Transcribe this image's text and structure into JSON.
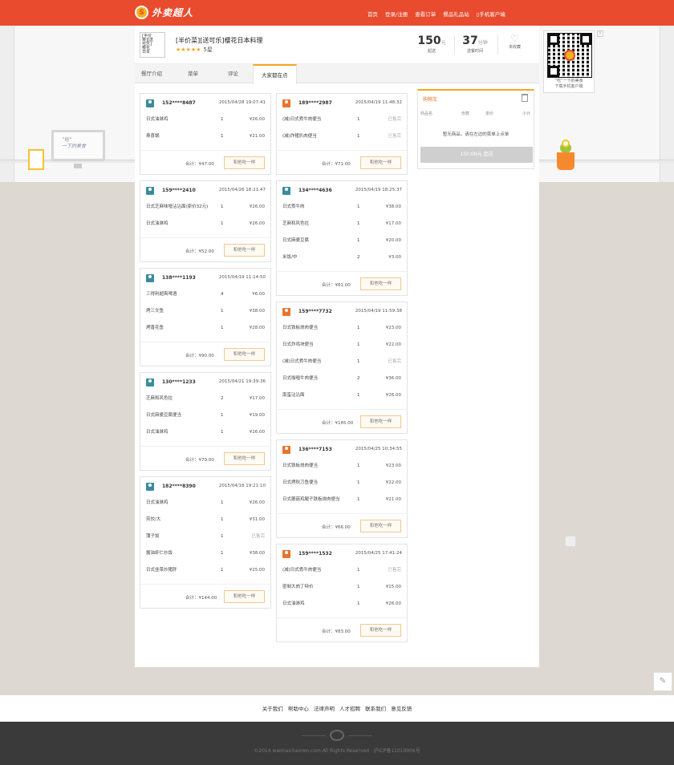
{
  "header": {
    "brand": "外卖超人",
    "nav": [
      "首页",
      "登录/注册",
      "查看订单",
      "餐品礼品站",
      "▯手机客户端"
    ]
  },
  "scene": {
    "screen_text": "“吃”\n一下的美食"
  },
  "restaurant": {
    "logo_text": "[半价\n菜][送\n可乐]\n樱花\n日本",
    "name": "[半价菜][送可乐]樱花日本料理",
    "stars": "★★★★★",
    "rating": "5星",
    "min_order": "150",
    "min_order_unit": "元",
    "min_order_label": "起送",
    "delivery_time": "37",
    "delivery_time_unit": "分钟",
    "delivery_time_label": "送餐时间",
    "favorite_label": "未收藏"
  },
  "tabs": [
    "餐厅介绍",
    "菜单",
    "评论",
    "大家都在点"
  ],
  "same_label": "和他吃一样",
  "left_orders": [
    {
      "user": "152****8487",
      "time": "2015/04/28 19:07:41",
      "avatar": "teal",
      "items": [
        {
          "name": "日式油淋鸡",
          "qty": "1",
          "price": "¥26.00"
        },
        {
          "name": "寿喜锅",
          "qty": "1",
          "price": "¥21.00"
        }
      ],
      "total": "合计：¥47.00"
    },
    {
      "user": "159****2410",
      "time": "2015/04/26 18:21:47",
      "avatar": "teal",
      "items": [
        {
          "name": "日式芝麻味噌沾沾面(原价32元)",
          "qty": "1",
          "price": "¥26.00"
        },
        {
          "name": "日式油淋鸡",
          "qty": "1",
          "price": "¥26.00"
        }
      ],
      "total": "合计：¥52.00"
    },
    {
      "user": "138****1193",
      "time": "2015/04/19 11:14:50",
      "avatar": "teal",
      "items": [
        {
          "name": "三得利超爽啤酒",
          "qty": "4",
          "price": "¥6.00"
        },
        {
          "name": "烤三文鱼",
          "qty": "1",
          "price": "¥38.00"
        },
        {
          "name": "烤香花鱼",
          "qty": "1",
          "price": "¥28.00"
        }
      ],
      "total": "合计：¥90.00"
    },
    {
      "user": "130****1233",
      "time": "2015/04/21 19:39:36",
      "avatar": "teal",
      "items": [
        {
          "name": "芝麻和风色拉",
          "qty": "2",
          "price": "¥17.00"
        },
        {
          "name": "日式麻婆豆腐便当",
          "qty": "1",
          "price": "¥19.00"
        },
        {
          "name": "日式油淋鸡",
          "qty": "1",
          "price": "¥26.00"
        }
      ],
      "total": "合计：¥79.00"
    },
    {
      "user": "182****8390",
      "time": "2015/04/18 19:21:10",
      "avatar": "teal",
      "items": [
        {
          "name": "日式油淋鸡",
          "qty": "1",
          "price": "¥26.00"
        },
        {
          "name": "煎饺/大",
          "qty": "1",
          "price": "¥31.00"
        },
        {
          "name": "蒲子饭",
          "qty": "1",
          "price": "已售完"
        },
        {
          "name": "酱油虾仁炒饭",
          "qty": "1",
          "price": "¥38.00"
        },
        {
          "name": "日式韭菜炒猪肝",
          "qty": "1",
          "price": "¥25.00"
        }
      ],
      "total": "合计：¥144.00"
    }
  ],
  "right_orders": [
    {
      "user": "189****2987",
      "time": "2015/04/19 11:48:32",
      "avatar": "orange",
      "items": [
        {
          "name": "(减)日式煮牛肉便当",
          "qty": "1",
          "price": "已售完"
        },
        {
          "name": "(减)炸猪扒肉便当",
          "qty": "1",
          "price": "已售完"
        }
      ],
      "total": "合计：¥71.00"
    },
    {
      "user": "134****4636",
      "time": "2015/04/19 18:25:37",
      "avatar": "teal",
      "items": [
        {
          "name": "日式煮牛肉",
          "qty": "1",
          "price": "¥38.00"
        },
        {
          "name": "芝麻和风色拉",
          "qty": "1",
          "price": "¥17.00"
        },
        {
          "name": "日式麻婆豆腐",
          "qty": "1",
          "price": "¥20.00"
        },
        {
          "name": "米饭/中",
          "qty": "2",
          "price": "¥3.00"
        }
      ],
      "total": "合计：¥81.00"
    },
    {
      "user": "159****7732",
      "time": "2015/04/19 11:59:38",
      "avatar": "orange",
      "items": [
        {
          "name": "日式铁板烧肉便当",
          "qty": "1",
          "price": "¥23.00"
        },
        {
          "name": "日式炸鸡块便当",
          "qty": "1",
          "price": "¥22.00"
        },
        {
          "name": "(减)日式煮牛肉便当",
          "qty": "1",
          "price": "已售完"
        },
        {
          "name": "日式咖喱牛肉便当",
          "qty": "2",
          "price": "¥36.00"
        },
        {
          "name": "南蛮沾沾面",
          "qty": "1",
          "price": "¥26.00"
        }
      ],
      "total": "合计：¥185.00"
    },
    {
      "user": "136****7153",
      "time": "2015/04/25 10:34:55",
      "avatar": "orange",
      "items": [
        {
          "name": "日式铁板烧肉便当",
          "qty": "1",
          "price": "¥23.00"
        },
        {
          "name": "日式烤秋刀鱼便当",
          "qty": "1",
          "price": "¥22.00"
        },
        {
          "name": "日式蘑菇鸡腿子铁板烧肉便当",
          "qty": "1",
          "price": "¥21.00"
        }
      ],
      "total": "合计：¥66.00"
    },
    {
      "user": "159****1532",
      "time": "2015/04/25 17:41:24",
      "avatar": "orange",
      "items": [
        {
          "name": "(减)日式煮牛肉便当",
          "qty": "1",
          "price": "已售完"
        },
        {
          "name": "密制大肉丁特价",
          "qty": "1",
          "price": "¥15.00"
        },
        {
          "name": "日式油淋鸡",
          "qty": "1",
          "price": "¥26.00"
        }
      ],
      "total": "合计：¥83.00"
    }
  ],
  "cart": {
    "title": "购物车",
    "headers": [
      "商品名",
      "份数",
      "单价",
      "小计"
    ],
    "empty_text": "暂无商品，请在左边的菜单上点单",
    "button": "150.00元 起送"
  },
  "qr": {
    "caption": "“吃”一下的美食\n下载手机客户端",
    "close": "X"
  },
  "footer": {
    "links": [
      "关于我们",
      "帮助中心",
      "法律声明",
      "人才招聘",
      "联系我们",
      "意见反馈"
    ],
    "copyright": "©2014 waimaichaoren.com All Rights Reserved · 沪ICP备11019906号"
  },
  "colors": {
    "brand": "#e84b2e",
    "accent": "#f2a81f",
    "soldout": "#aaaaaa"
  }
}
